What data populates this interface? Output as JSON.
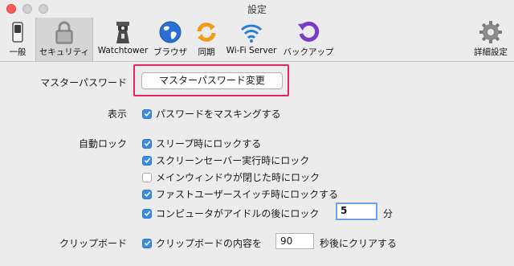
{
  "window": {
    "title": "設定"
  },
  "toolbar": {
    "items": [
      {
        "label": "一般",
        "icon": "switch-icon"
      },
      {
        "label": "セキュリティ",
        "icon": "lock-icon"
      },
      {
        "label": "Watchtower",
        "icon": "tower-icon"
      },
      {
        "label": "ブラウザ",
        "icon": "globe-icon"
      },
      {
        "label": "同期",
        "icon": "sync-icon"
      },
      {
        "label": "Wi-Fi Server",
        "icon": "wifi-icon"
      },
      {
        "label": "バックアップ",
        "icon": "backup-icon"
      },
      {
        "label": "詳細設定",
        "icon": "gear-icon"
      }
    ],
    "selected": "セキュリティ"
  },
  "master_password": {
    "label": "マスターパスワード",
    "button": "マスターパスワード変更"
  },
  "display": {
    "label": "表示",
    "mask": {
      "label": "パスワードをマスキングする",
      "checked": true
    }
  },
  "autolock": {
    "label": "自動ロック",
    "options": [
      {
        "label": "スリープ時にロックする",
        "checked": true
      },
      {
        "label": "スクリーンセーバー実行時にロック",
        "checked": true
      },
      {
        "label": "メインウィンドウが閉じた時にロック",
        "checked": false
      },
      {
        "label": "ファストユーザースイッチ時にロックする",
        "checked": true
      },
      {
        "label": "コンピュータがアイドルの後にロック",
        "checked": true
      }
    ],
    "idle_minutes": "5",
    "idle_unit": "分"
  },
  "clipboard": {
    "label": "クリップボード",
    "option": {
      "label": "クリップボードの内容を",
      "checked": true
    },
    "seconds": "90",
    "suffix": "秒後にクリアする"
  },
  "colors": {
    "accent": "#3a8ae8",
    "highlight": "#e8206a"
  }
}
